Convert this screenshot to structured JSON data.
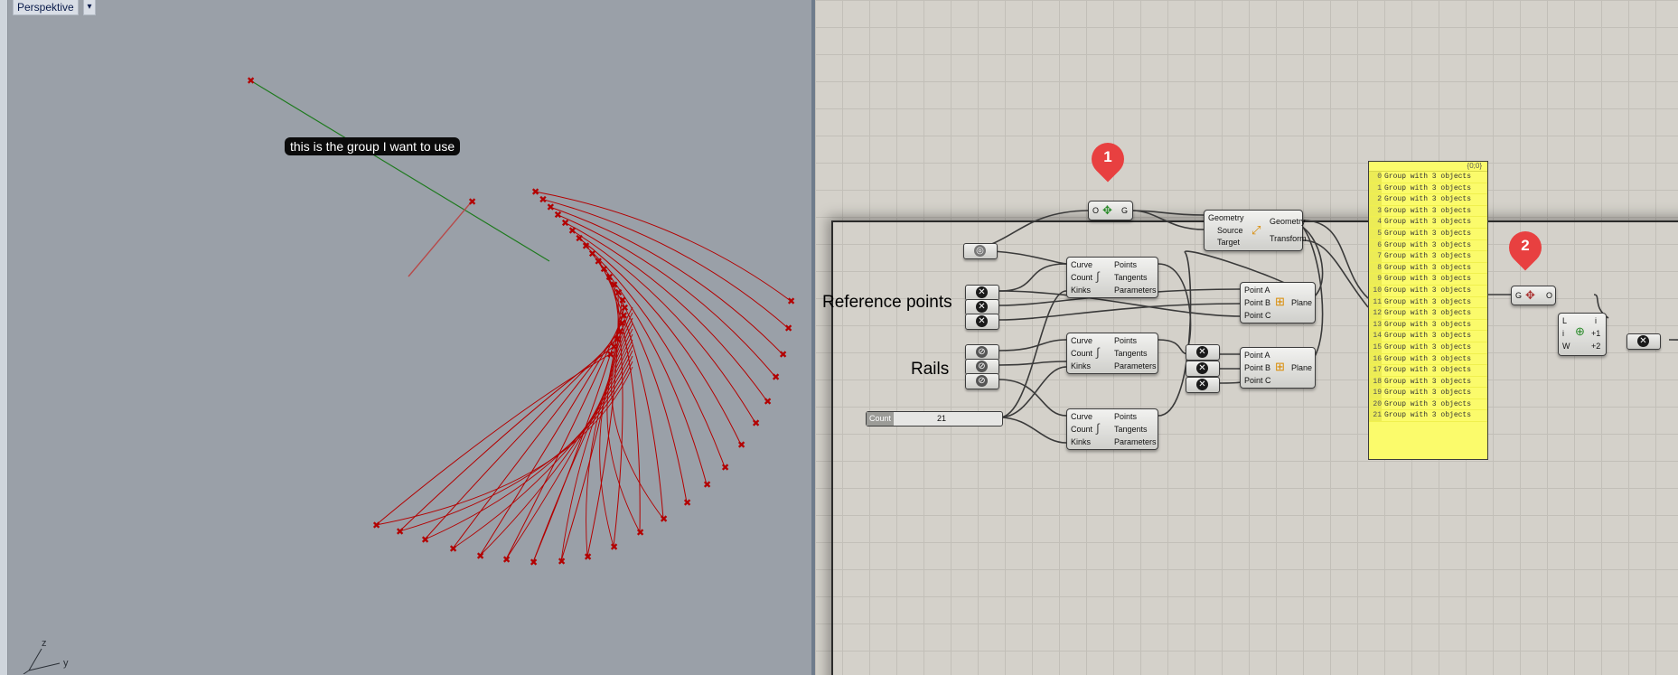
{
  "viewport": {
    "title": "Perspektive",
    "menu_glyph": "▾",
    "annotation": "this is the group I want to use",
    "axis_labels": {
      "z": "z",
      "y": "y"
    }
  },
  "canvas": {
    "labels": {
      "reference_points": "Reference points",
      "rails": "Rails"
    },
    "markers": [
      "1",
      "2"
    ],
    "ungroup_component": {
      "in": "O",
      "out": "G"
    },
    "group_component": {
      "in": "G",
      "out": "O"
    },
    "orient_component": {
      "inputs": [
        "Geometry",
        "Source",
        "Target"
      ],
      "outputs": [
        "Geometry",
        "Transform"
      ]
    },
    "divide_components": {
      "inputs": [
        "Curve",
        "Count",
        "Kinks"
      ],
      "outputs": [
        "Points",
        "Tangents",
        "Parameters"
      ]
    },
    "plane_components": {
      "inputs": [
        "Point A",
        "Point B",
        "Point C"
      ],
      "output": "Plane"
    },
    "list_item": {
      "inputs": [
        "L",
        "i",
        "W"
      ],
      "outputs": [
        "i",
        "+1",
        "+2"
      ]
    },
    "slider": {
      "name": "Count",
      "value": "21"
    },
    "panel": {
      "header": "{0;0}",
      "rows": [
        "Group with 3 objects",
        "Group with 3 objects",
        "Group with 3 objects",
        "Group with 3 objects",
        "Group with 3 objects",
        "Group with 3 objects",
        "Group with 3 objects",
        "Group with 3 objects",
        "Group with 3 objects",
        "Group with 3 objects",
        "Group with 3 objects",
        "Group with 3 objects",
        "Group with 3 objects",
        "Group with 3 objects",
        "Group with 3 objects",
        "Group with 3 objects",
        "Group with 3 objects",
        "Group with 3 objects",
        "Group with 3 objects",
        "Group with 3 objects",
        "Group with 3 objects",
        "Group with 3 objects"
      ],
      "indices": [
        "0",
        "1",
        "2",
        "3",
        "4",
        "5",
        "6",
        "7",
        "8",
        "9",
        "10",
        "11",
        "12",
        "13",
        "14",
        "15",
        "16",
        "17",
        "18",
        "19",
        "20",
        "21"
      ]
    },
    "colors": {
      "panel": "#fbfb6b",
      "marker": "#e84040",
      "curve": "#b30000",
      "line_green": "#1e7a1e"
    }
  }
}
